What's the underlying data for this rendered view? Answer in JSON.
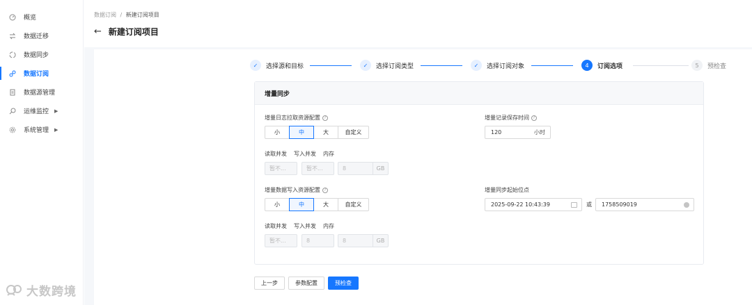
{
  "sidebar": {
    "items": [
      {
        "label": "概览",
        "icon": "dashboard-icon"
      },
      {
        "label": "数据迁移",
        "icon": "migrate-icon"
      },
      {
        "label": "数据同步",
        "icon": "sync-icon"
      },
      {
        "label": "数据订阅",
        "icon": "subscribe-icon",
        "active": true
      },
      {
        "label": "数据源管理",
        "icon": "datasource-icon"
      },
      {
        "label": "运维监控",
        "icon": "monitor-icon",
        "has_children": true
      },
      {
        "label": "系统管理",
        "icon": "settings-icon",
        "has_children": true
      }
    ]
  },
  "watermark": {
    "text": "大数跨境"
  },
  "header": {
    "breadcrumb": {
      "parent": "数据订阅",
      "separator": "/",
      "current": "新建订阅项目"
    },
    "title": "新建订阅项目"
  },
  "steps": [
    {
      "index": "1",
      "label": "选择源和目标",
      "status": "done"
    },
    {
      "index": "2",
      "label": "选择订阅类型",
      "status": "done"
    },
    {
      "index": "3",
      "label": "选择订阅对象",
      "status": "done"
    },
    {
      "index": "4",
      "label": "订阅选项",
      "status": "current"
    },
    {
      "index": "5",
      "label": "预检查",
      "status": "wait"
    }
  ],
  "card": {
    "title": "增量同步",
    "log_pull": {
      "label": "增量日志拉取资源配置",
      "options": [
        "小",
        "中",
        "大",
        "自定义"
      ],
      "selected": "中",
      "sub_labels": [
        "读取并发",
        "写入并发",
        "内存"
      ],
      "read_value": "暂不...",
      "write_value": "暂不...",
      "memory_value": "8",
      "memory_unit": "GB"
    },
    "retention": {
      "label": "增量记录保存时间",
      "value": "120",
      "unit": "小时"
    },
    "write": {
      "label": "增量数据写入资源配置",
      "options": [
        "小",
        "中",
        "大",
        "自定义"
      ],
      "selected": "中",
      "sub_labels": [
        "读取并发",
        "写入并发",
        "内存"
      ],
      "read_value": "暂不...",
      "write_value": "8",
      "memory_value": "8",
      "memory_unit": "GB"
    },
    "start_position": {
      "label": "增量同步起始位点",
      "datetime": "2025-09-22 10:43:39",
      "or_text": "或",
      "timestamp": "1758509019"
    }
  },
  "footer": {
    "prev": "上一步",
    "params": "参数配置",
    "precheck": "预检查"
  },
  "colors": {
    "primary": "#1677ff"
  }
}
